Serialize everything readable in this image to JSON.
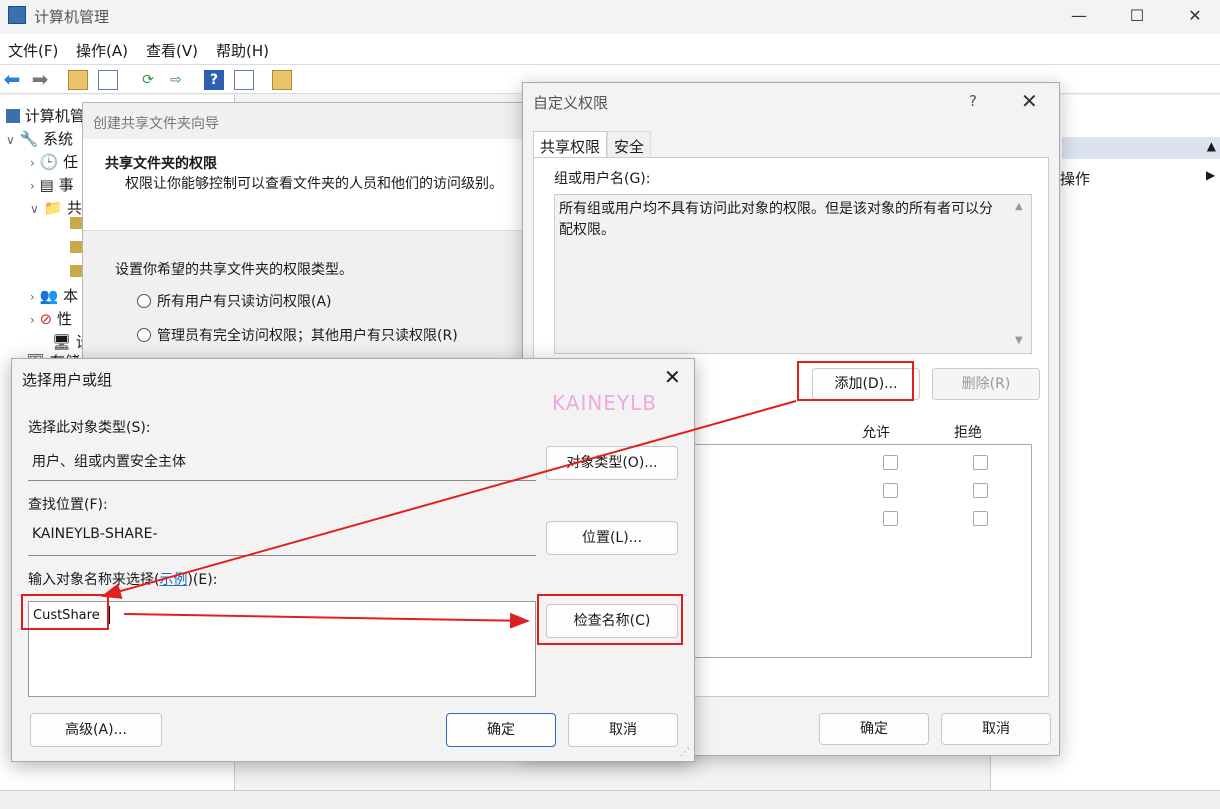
{
  "window": {
    "title": "计算机管理",
    "minimize": "—",
    "maximize": "☐",
    "close": "✕"
  },
  "menu": [
    "文件(F)",
    "操作(A)",
    "查看(V)",
    "帮助(H)"
  ],
  "toolbar_icons": [
    "back-icon",
    "forward-icon",
    "folder-up-icon",
    "show-hide-tree-icon",
    "refresh-icon",
    "export-icon",
    "help-icon",
    "properties-icon",
    "new-share-icon"
  ],
  "tree": {
    "root": "计算机管",
    "system": "系统",
    "items": [
      "任",
      "事",
      "共",
      "本",
      "性",
      "设"
    ],
    "storage": "存储"
  },
  "actions": {
    "label": "操作"
  },
  "wizard": {
    "title": "创建共享文件夹向导",
    "heading": "共享文件夹的权限",
    "subheading": "权限让你能够控制可以查看文件夹的人员和他们的访问级别。",
    "prompt": "设置你希望的共享文件夹的权限类型。",
    "options": [
      "所有用户有只读访问权限(A)",
      "管理员有完全访问权限；其他用户有只读权限(R)"
    ]
  },
  "perm": {
    "title": "自定义权限",
    "help": "?",
    "close": "✕",
    "tabs": [
      "共享权限",
      "安全"
    ],
    "group_label": "组或用户名(G):",
    "group_text": "所有组或用户均不具有访问此对象的权限。但是该对象的所有者可以分配权限。",
    "add_button": "添加(D)...",
    "remove_button": "删除(R)",
    "allow": "允许",
    "deny": "拒绝",
    "ok": "确定",
    "cancel": "取消"
  },
  "select": {
    "title": "选择用户或组",
    "close": "✕",
    "watermark": "KAINEYLB",
    "obj_type_label": "选择此对象类型(S):",
    "obj_type_value": "用户、组或内置安全主体",
    "obj_type_button": "对象类型(O)...",
    "location_label": "查找位置(F):",
    "location_value": "KAINEYLB-SHARE-",
    "location_button": "位置(L)...",
    "name_label_prefix": "输入对象名称来选择(",
    "name_label_link": "示例",
    "name_label_suffix": ")(E):",
    "name_value": "CustShare",
    "check_button": "检查名称(C)",
    "advanced_button": "高级(A)...",
    "ok": "确定",
    "cancel": "取消"
  },
  "colors": {
    "annotation": "#e02020",
    "link": "#1d6fb8",
    "watermark": "#f0a8e0"
  }
}
